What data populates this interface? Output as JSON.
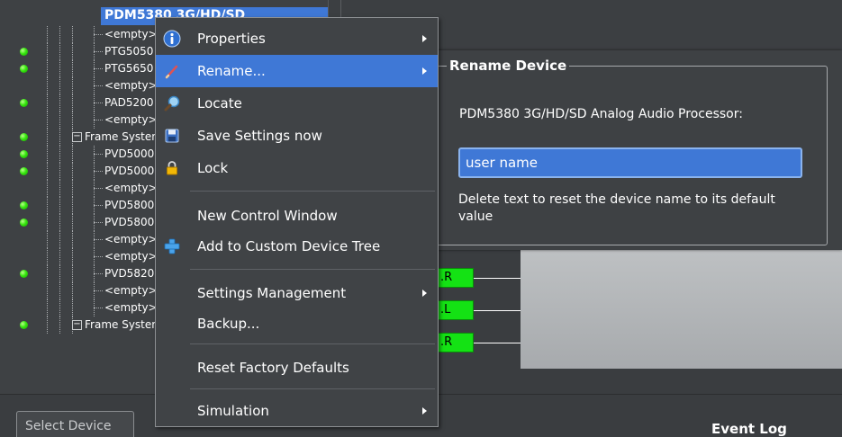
{
  "tree": {
    "selected_label": "PDM5380 3G/HD/SD",
    "rows": [
      {
        "label": "<empty>",
        "led": false,
        "kind": "leaf"
      },
      {
        "label": "PTG5050",
        "led": true,
        "kind": "leaf"
      },
      {
        "label": "PTG5650",
        "led": true,
        "kind": "leaf"
      },
      {
        "label": "<empty>",
        "led": false,
        "kind": "leaf"
      },
      {
        "label": "PAD5200",
        "led": true,
        "kind": "leaf"
      },
      {
        "label": "<empty>",
        "led": false,
        "kind": "leaf"
      },
      {
        "label": "Frame System",
        "led": true,
        "kind": "frame"
      },
      {
        "label": "PVD5000",
        "led": true,
        "kind": "leaf"
      },
      {
        "label": "PVD5000",
        "led": true,
        "kind": "leaf"
      },
      {
        "label": "<empty>",
        "led": false,
        "kind": "leaf"
      },
      {
        "label": "PVD5800",
        "led": true,
        "kind": "leaf"
      },
      {
        "label": "PVD5800",
        "led": true,
        "kind": "leaf"
      },
      {
        "label": "<empty>",
        "led": false,
        "kind": "leaf"
      },
      {
        "label": "<empty>",
        "led": false,
        "kind": "leaf"
      },
      {
        "label": "PVD5820",
        "led": true,
        "kind": "leaf"
      },
      {
        "label": "<empty>",
        "led": false,
        "kind": "leaf"
      },
      {
        "label": "<empty>",
        "led": false,
        "kind": "leaf"
      },
      {
        "label": "Frame System",
        "led": true,
        "kind": "frame"
      }
    ]
  },
  "context_menu": {
    "items": [
      {
        "label": "Properties",
        "icon": "info-icon",
        "submenu": true
      },
      {
        "label": "Rename...",
        "icon": "pencil-icon",
        "submenu": true,
        "highlighted": true
      },
      {
        "label": "Locate",
        "icon": "magnifier-icon",
        "submenu": false
      },
      {
        "label": "Save Settings now",
        "icon": "floppy-disk-icon",
        "submenu": false
      },
      {
        "label": "Lock",
        "icon": "padlock-icon",
        "submenu": false
      },
      {
        "label": "New Control Window",
        "icon": "",
        "submenu": false
      },
      {
        "label": "Add to Custom Device Tree",
        "icon": "plus-cross-icon",
        "submenu": false
      },
      {
        "label": "Settings Management",
        "icon": "",
        "submenu": true
      },
      {
        "label": "Backup...",
        "icon": "",
        "submenu": false
      },
      {
        "label": "Reset Factory Defaults",
        "icon": "",
        "submenu": false
      },
      {
        "label": "Simulation",
        "icon": "",
        "submenu": true
      }
    ]
  },
  "rename_dialog": {
    "title": "Rename Device",
    "device_label": "PDM5380 3G/HD/SD Analog Audio Processor:",
    "input_value": "user name",
    "hint": "Delete text to reset the device name to its default value"
  },
  "diagram": {
    "tags": [
      ".R",
      ".L",
      ".R"
    ]
  },
  "bottom": {
    "select_device_label": "Select Device",
    "event_log_title": "Event Log"
  },
  "colors": {
    "selection": "#3f78d6",
    "led_green": "#37e60f",
    "tag_green": "#14e214",
    "background": "#3a3d40"
  }
}
